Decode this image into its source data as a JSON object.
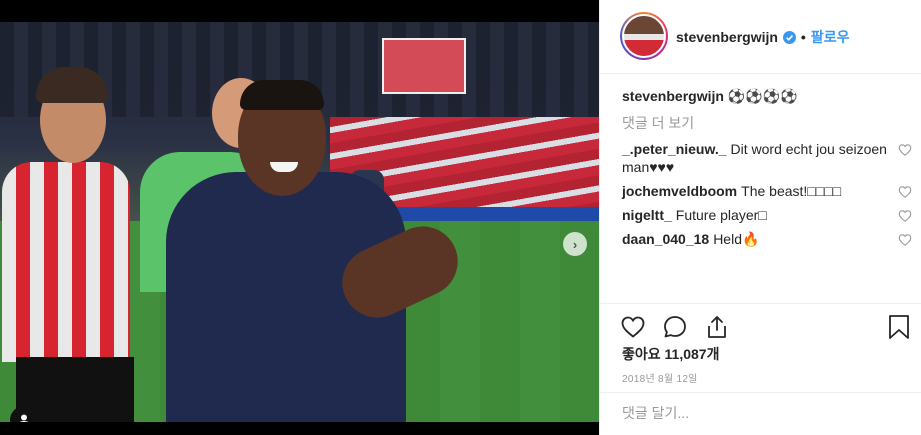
{
  "post": {
    "carousel": {
      "slide_count": 5,
      "active_index": 0
    }
  },
  "header": {
    "username": "stevenbergwijn",
    "separator": "•",
    "follow_label": "팔로우"
  },
  "caption": {
    "username": "stevenbergwijn",
    "text": "⚽⚽⚽⚽"
  },
  "more_comments_label": "댓글 더 보기",
  "comments": [
    {
      "username": "_.peter_nieuw._",
      "text": "Dit word echt jou seizoen man♥♥♥"
    },
    {
      "username": "jochemveldboom",
      "text": "The beast!□□□□"
    },
    {
      "username": "nigeltt_",
      "text": "Future player□"
    },
    {
      "username": "daan_040_18",
      "text": "Held🔥"
    }
  ],
  "likes": {
    "label": "좋아요",
    "count": "11,087개"
  },
  "date": "2018년 8월 12일",
  "comment_input": {
    "placeholder": "댓글 달기..."
  },
  "colors": {
    "accent": "#3897f0",
    "text": "#262626",
    "muted": "#999999"
  },
  "icons": [
    "verified-icon",
    "heart-icon",
    "comment-icon",
    "share-icon",
    "bookmark-icon",
    "chevron-right-icon",
    "user-tag-icon"
  ]
}
